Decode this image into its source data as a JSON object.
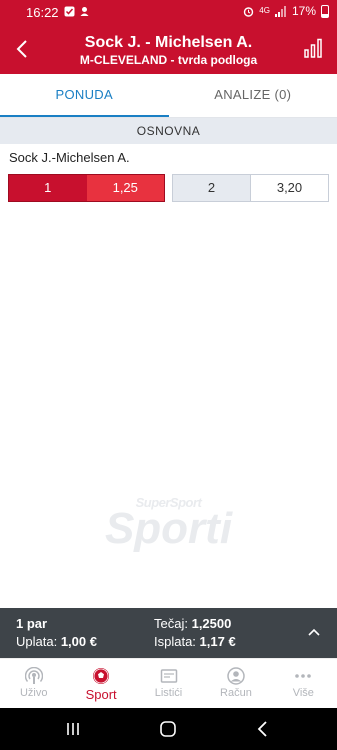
{
  "status_bar": {
    "time": "16:22",
    "network": "4G",
    "battery": "17%"
  },
  "header": {
    "title": "Sock J. - Michelsen A.",
    "subtitle": "M-CLEVELAND - tvrda podloga"
  },
  "tabs": [
    {
      "label": "PONUDA",
      "active": true
    },
    {
      "label": "ANALIZE (0)",
      "active": false
    }
  ],
  "section": {
    "title": "OSNOVNA"
  },
  "match": {
    "name": "Sock J.-Michelsen A.",
    "odds": [
      {
        "label": "1",
        "value": "1,25",
        "selected": true
      },
      {
        "label": "2",
        "value": "3,20",
        "selected": false
      }
    ]
  },
  "watermark": {
    "small": "SuperSport",
    "big": "Sporti"
  },
  "betslip": {
    "pairs": "1 par",
    "uplata_label": "Uplata:",
    "uplata_value": "1,00 €",
    "tecaj_label": "Tečaj:",
    "tecaj_value": "1,2500",
    "isplata_label": "Isplata:",
    "isplata_value": "1,17 €"
  },
  "bottom_nav": [
    {
      "label": "Uživo",
      "icon": "live-icon",
      "active": false
    },
    {
      "label": "Sport",
      "icon": "ball-icon",
      "active": true
    },
    {
      "label": "Listići",
      "icon": "ticket-icon",
      "active": false
    },
    {
      "label": "Račun",
      "icon": "account-icon",
      "active": false
    },
    {
      "label": "Više",
      "icon": "more-icon",
      "active": false
    }
  ],
  "colors": {
    "brand_red": "#c8102e",
    "tab_active": "#1a7fc4",
    "betslip_bg": "#3e4449"
  }
}
